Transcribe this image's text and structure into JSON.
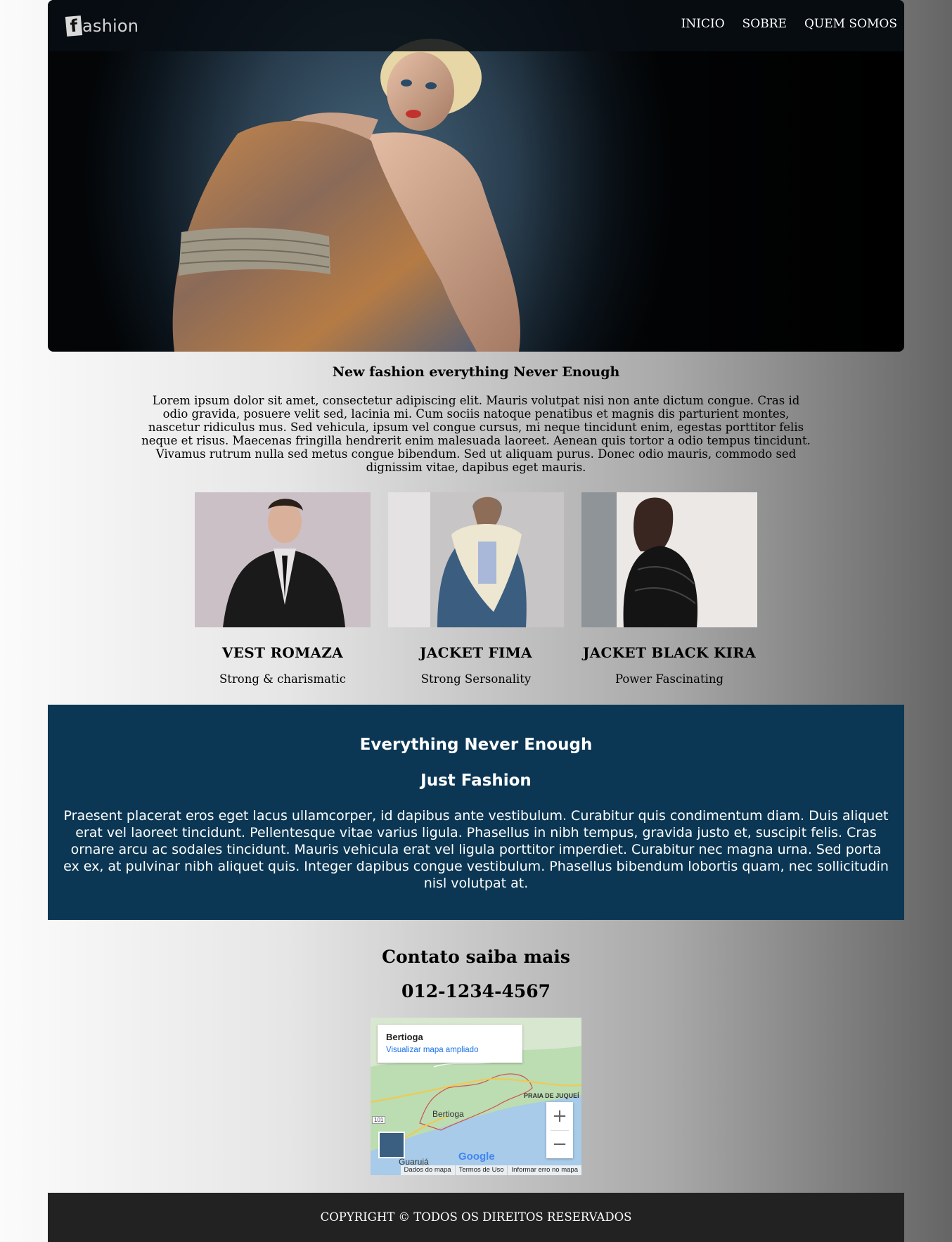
{
  "header": {
    "logo_letter": "f",
    "logo_text": "ashion",
    "nav": [
      "INICIO",
      "SOBRE",
      "QUEM SOMOS"
    ]
  },
  "intro": {
    "title": "New fashion everything Never Enough",
    "text": "Lorem ipsum dolor sit amet, consectetur adipiscing elit. Mauris volutpat nisi non ante dictum congue. Cras id odio gravida, posuere velit sed, lacinia mi. Cum sociis natoque penatibus et magnis dis parturient montes, nascetur ridiculus mus. Sed vehicula, ipsum vel congue cursus, mi neque tincidunt enim, egestas porttitor felis neque et risus. Maecenas fringilla hendrerit enim malesuada laoreet. Aenean quis tortor a odio tempus tincidunt. Vivamus rutrum nulla sed metus congue bibendum. Sed ut aliquam purus. Donec odio mauris, commodo sed dignissim vitae, dapibus eget mauris."
  },
  "products": [
    {
      "name": "VEST ROMAZA",
      "subtitle": "Strong & charismatic"
    },
    {
      "name": "JACKET FIMA",
      "subtitle": "Strong Sersonality"
    },
    {
      "name": "JACKET BLACK KIRA",
      "subtitle": "Power Fascinating"
    }
  ],
  "banner": {
    "heading1": "Everything Never Enough",
    "heading2": "Just Fashion",
    "text": "Praesent placerat eros eget lacus ullamcorper, id dapibus ante vestibulum. Curabitur quis condimentum diam. Duis aliquet erat vel laoreet tincidunt. Pellentesque vitae varius ligula. Phasellus in nibh tempus, gravida justo et, suscipit felis. Cras ornare arcu ac sodales tincidunt. Mauris vehicula erat vel ligula porttitor imperdiet. Curabitur nec magna urna. Sed porta ex ex, at pulvinar nibh aliquet quis. Integer dapibus congue vestibulum. Phasellus bibendum lobortis quam, nec sollicitudin nisl volutpat at.",
    "background_color": "#0b3754"
  },
  "contact": {
    "title": "Contato saiba mais",
    "phone": "012-1234-4567"
  },
  "map": {
    "place": "Bertioga",
    "link": "Visualizar mapa ampliado",
    "labels": {
      "praia": "PRAIA DE JUQUEÍ",
      "city": "Bertioga",
      "guaruja": "Guarujá",
      "road": "101"
    },
    "google": "Google",
    "footer": [
      "Dados do mapa",
      "Termos de Uso",
      "Informar erro no mapa"
    ],
    "zoom_in": "+",
    "zoom_out": "−"
  },
  "footer": {
    "copyright": "COPYRIGHT © TODOS OS DIREITOS RESERVADOS",
    "background_color": "#222222"
  }
}
